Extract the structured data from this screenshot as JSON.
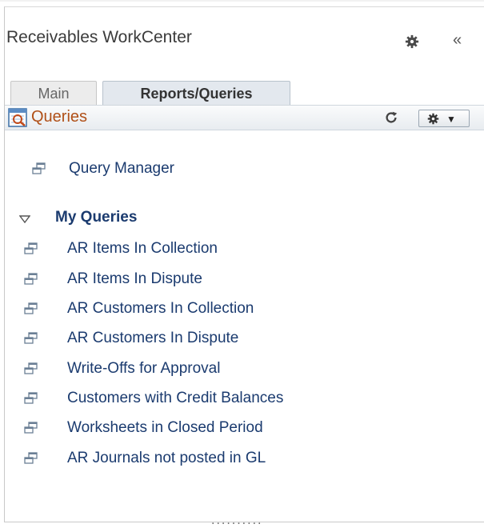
{
  "header": {
    "title": "Receivables WorkCenter",
    "gear_icon": "gear-icon",
    "collapse_icon": "double-chevron-left-icon",
    "collapse_glyph": "«"
  },
  "tabs": [
    {
      "label": "Main",
      "active": false
    },
    {
      "label": "Reports/Queries",
      "active": true
    }
  ],
  "section": {
    "title": "Queries",
    "icon": "queries-icon",
    "refresh_icon": "refresh-icon",
    "options_icon": "gear-dropdown-icon",
    "options_caret": "▼"
  },
  "top_links": [
    {
      "label": "Query Manager",
      "icon": "window-link-icon"
    }
  ],
  "group": {
    "label": "My Queries",
    "expanded": true,
    "items": [
      {
        "label": "AR Items In Collection"
      },
      {
        "label": "AR Items In Dispute"
      },
      {
        "label": "AR Customers In Collection"
      },
      {
        "label": "AR Customers In Dispute"
      },
      {
        "label": "Write-Offs for Approval"
      },
      {
        "label": "Customers with Credit Balances"
      },
      {
        "label": "Worksheets in Closed Period"
      },
      {
        "label": "AR Journals not posted in GL"
      }
    ]
  },
  "resize_handle": "..........",
  "colors": {
    "section_title": "#b05018",
    "link": "#1b3b6f",
    "active_tab_bg": "#e3e8ee"
  }
}
